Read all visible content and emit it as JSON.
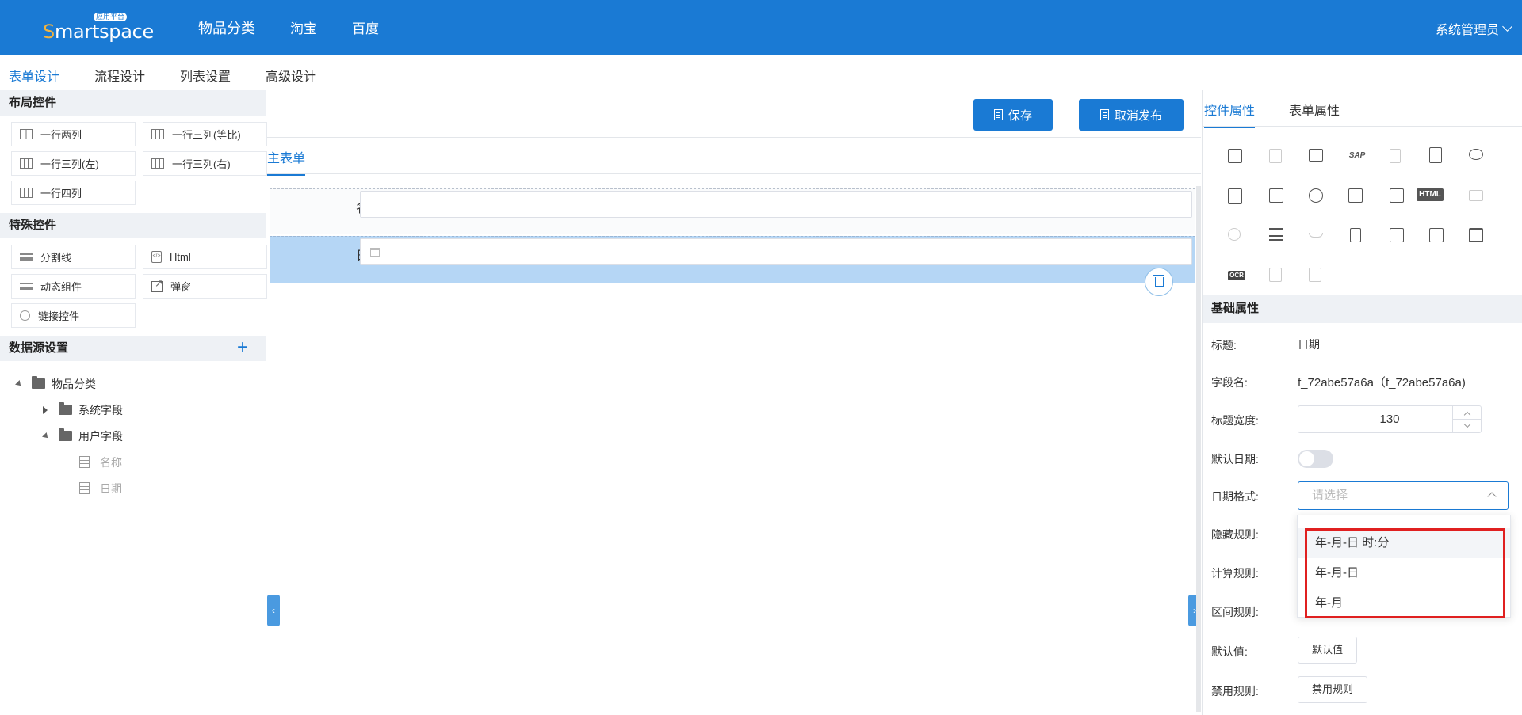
{
  "header": {
    "logo_text": "Smartspace",
    "logo_badge": "应用平台",
    "nav": [
      "物品分类",
      "淘宝",
      "百度"
    ],
    "user": "系统管理员"
  },
  "tabs": [
    "表单设计",
    "流程设计",
    "列表设置",
    "高级设计"
  ],
  "left": {
    "layout_title": "布局控件",
    "layout_items": [
      "一行两列",
      "一行三列(等比)",
      "一行三列(左)",
      "一行三列(右)",
      "一行四列"
    ],
    "special_title": "特殊控件",
    "special_items": [
      "分割线",
      "Html",
      "动态组件",
      "弹窗",
      "链接控件"
    ],
    "datasource_title": "数据源设置",
    "tree": {
      "root": "物品分类",
      "system": "系统字段",
      "user": "用户字段",
      "fields": [
        "名称",
        "日期"
      ]
    }
  },
  "center": {
    "save": "保存",
    "unpublish": "取消发布",
    "subtab": "主表单",
    "rows": [
      {
        "label": "名称"
      },
      {
        "label": "日期"
      }
    ]
  },
  "right": {
    "tabs": [
      "控件属性",
      "表单属性"
    ],
    "basic_title": "基础属性",
    "props": {
      "title_label": "标题:",
      "title_value": "日期",
      "field_label": "字段名:",
      "field_value": "f_72abe57a6a（f_72abe57a6a)",
      "width_label": "标题宽度:",
      "width_value": "130",
      "default_date_label": "默认日期:",
      "format_label": "日期格式:",
      "format_placeholder": "请选择",
      "hide_label": "隐藏规则:",
      "calc_label": "计算规则:",
      "range_label": "区间规则:",
      "default_label": "默认值:",
      "default_button": "默认值",
      "disable_label": "禁用规则:",
      "disable_button": "禁用规则"
    },
    "icon_html": "HTML",
    "icon_ocr": "OCR",
    "icon_sap": "SAP"
  },
  "dropdown": {
    "options": [
      "年-月-日 时:分",
      "年-月-日",
      "年-月"
    ]
  },
  "colors": {
    "primary": "#1a7ad4",
    "highlight": "#e02020",
    "selected_row": "#b5d6f5"
  }
}
